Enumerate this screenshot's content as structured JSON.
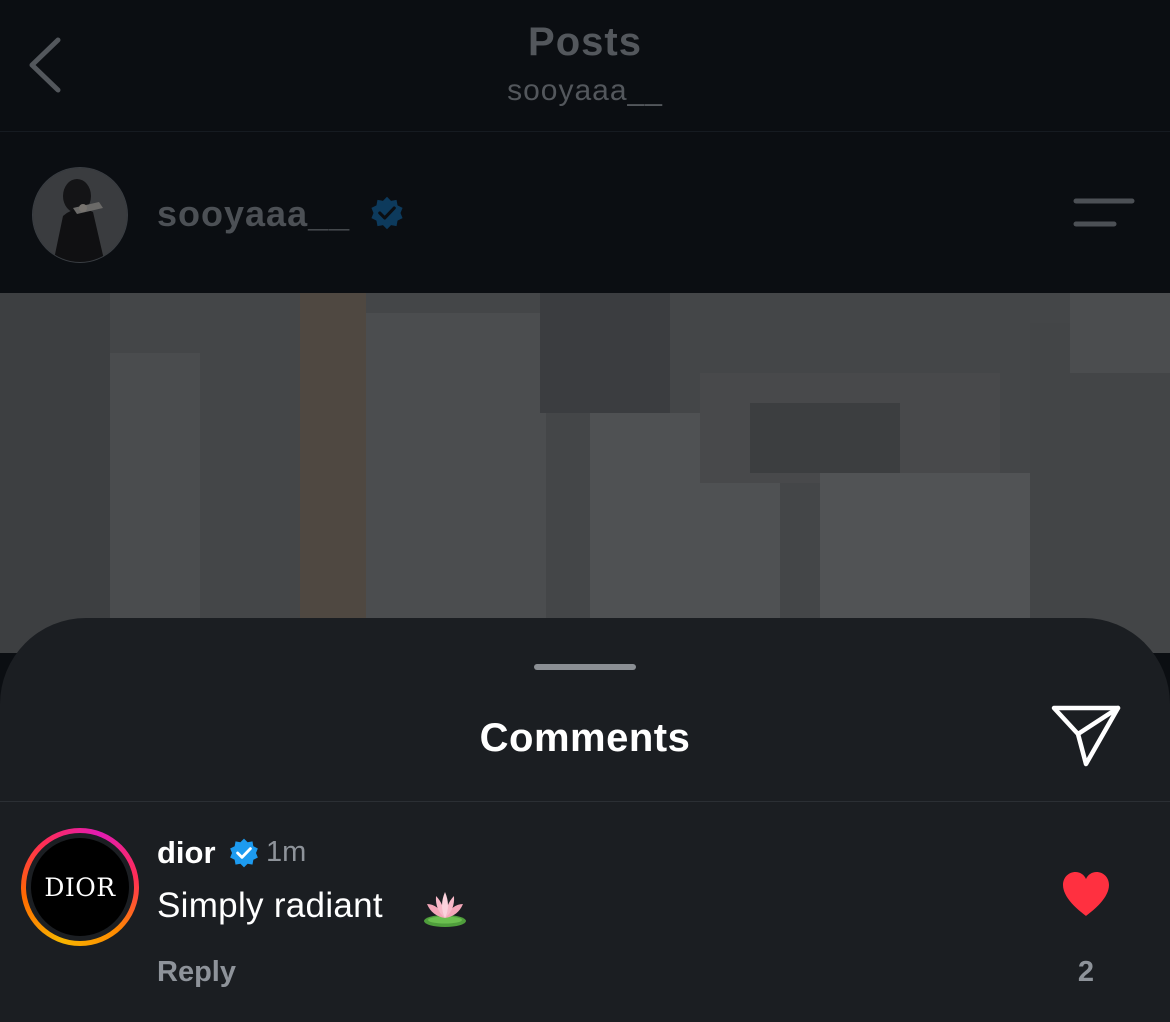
{
  "header": {
    "title": "Posts",
    "subtitle": "sooyaaa__"
  },
  "post": {
    "username": "sooyaaa__",
    "verified": true
  },
  "comments_sheet": {
    "title": "Comments",
    "comments": [
      {
        "username": "dior",
        "avatar_logo": "DIOR",
        "verified": true,
        "time": "1m",
        "text": "Simply radiant",
        "emoji": "lotus-icon",
        "reply_label": "Reply",
        "likes": "2",
        "liked": true
      }
    ]
  },
  "colors": {
    "verified": "#1d9bf0",
    "like": "#ff3040",
    "sheet_bg": "#1b1e22",
    "app_bg": "#0b0e12"
  }
}
